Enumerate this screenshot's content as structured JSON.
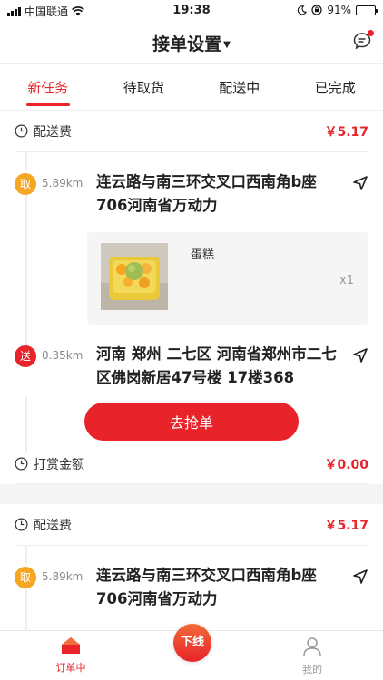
{
  "status_bar": {
    "carrier": "中国联通",
    "time": "19:38",
    "battery": "91%",
    "battery_level": 0.91
  },
  "nav": {
    "title": "接单设置"
  },
  "tabs": [
    {
      "label": "新任务",
      "active": true
    },
    {
      "label": "待取货",
      "active": false
    },
    {
      "label": "配送中",
      "active": false
    },
    {
      "label": "已完成",
      "active": false
    }
  ],
  "orders": [
    {
      "fee_label": "配送费",
      "fee": "￥5.17",
      "pickup": {
        "badge": "取",
        "distance": "5.89km",
        "address": "连云路与南三环交叉口西南角b座706河南省万动力"
      },
      "goods": {
        "name": "蛋糕",
        "qty": "x1"
      },
      "delivery": {
        "badge": "送",
        "distance": "0.35km",
        "address": "河南 郑州 二七区 河南省郑州市二七区佛岗新居47号楼 17楼368"
      },
      "grab_label": "去抢单",
      "reward_label": "打赏金额",
      "reward": "￥0.00"
    },
    {
      "fee_label": "配送费",
      "fee": "￥5.17",
      "pickup": {
        "badge": "取",
        "distance": "5.89km",
        "address": "连云路与南三环交叉口西南角b座706河南省万动力"
      }
    }
  ],
  "bottom_bar": {
    "orders_label": "订单中",
    "offline_label": "下线",
    "mine_label": "我的"
  },
  "colors": {
    "accent": "#e8232a",
    "pickup_badge": "#f5a623"
  }
}
